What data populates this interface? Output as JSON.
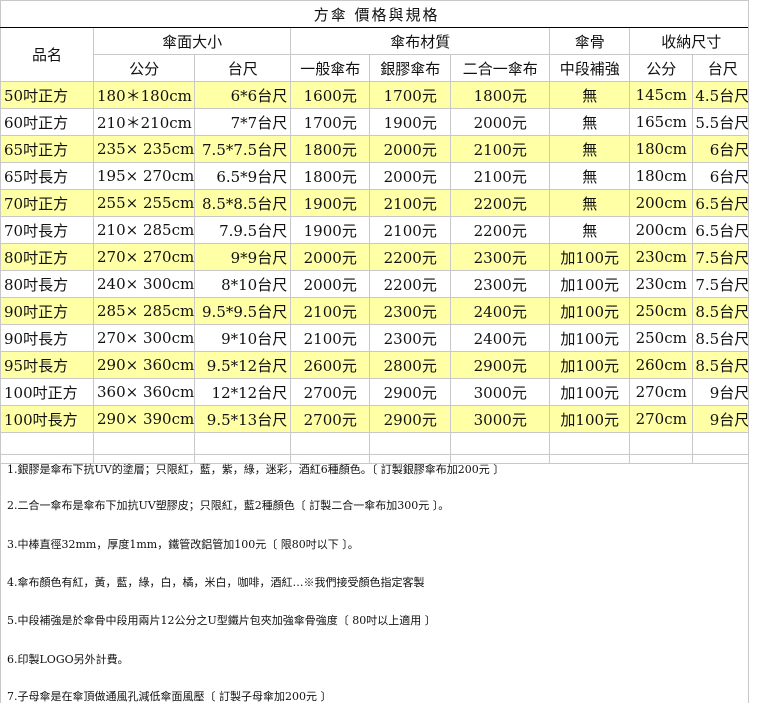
{
  "title": "方傘 價格與規格",
  "headers": {
    "product": "品名",
    "canopy": "傘面大小",
    "fabric": "傘布材質",
    "rib": "傘骨",
    "folded": "收納尺寸",
    "cm": "公分",
    "taichi": "台尺",
    "normal": "一般傘布",
    "silver": "銀膠傘布",
    "combo": "二合一傘布",
    "mid": "中段補強",
    "fcm": "公分",
    "ftai": "台尺"
  },
  "rows": [
    {
      "name": "50吋正方",
      "cm": "180＊180cm",
      "tai": "6*6台尺",
      "p1": "1600元",
      "p2": "1700元",
      "p3": "1800元",
      "mid": "無",
      "fcm": "145cm",
      "ftai": "4.5台尺",
      "hl": true
    },
    {
      "name": "60吋正方",
      "cm": "210＊210cm",
      "tai": "7*7台尺",
      "p1": "1700元",
      "p2": "1900元",
      "p3": "2000元",
      "mid": "無",
      "fcm": "165cm",
      "ftai": "5.5台尺",
      "hl": false
    },
    {
      "name": "65吋正方",
      "cm": "235× 235cm",
      "tai": "7.5*7.5台尺",
      "p1": "1800元",
      "p2": "2000元",
      "p3": "2100元",
      "mid": "無",
      "fcm": "180cm",
      "ftai": "6台尺",
      "hl": true
    },
    {
      "name": "65吋長方",
      "cm": "195× 270cm",
      "tai": "6.5*9台尺",
      "p1": "1800元",
      "p2": "2000元",
      "p3": "2100元",
      "mid": "無",
      "fcm": "180cm",
      "ftai": "6台尺",
      "hl": false
    },
    {
      "name": "70吋正方",
      "cm": "255× 255cm",
      "tai": "8.5*8.5台尺",
      "p1": "1900元",
      "p2": "2100元",
      "p3": "2200元",
      "mid": "無",
      "fcm": "200cm",
      "ftai": "6.5台尺",
      "hl": true
    },
    {
      "name": "70吋長方",
      "cm": "210× 285cm",
      "tai": "7.9.5台尺",
      "p1": "1900元",
      "p2": "2100元",
      "p3": "2200元",
      "mid": "無",
      "fcm": "200cm",
      "ftai": "6.5台尺",
      "hl": false
    },
    {
      "name": "80吋正方",
      "cm": "270× 270cm",
      "tai": "9*9台尺",
      "p1": "2000元",
      "p2": "2200元",
      "p3": "2300元",
      "mid": "加100元",
      "fcm": "230cm",
      "ftai": "7.5台尺",
      "hl": true
    },
    {
      "name": "80吋長方",
      "cm": "240× 300cm",
      "tai": "8*10台尺",
      "p1": "2000元",
      "p2": "2200元",
      "p3": "2300元",
      "mid": "加100元",
      "fcm": "230cm",
      "ftai": "7.5台尺",
      "hl": false
    },
    {
      "name": "90吋正方",
      "cm": "285× 285cm",
      "tai": "9.5*9.5台尺",
      "p1": "2100元",
      "p2": "2300元",
      "p3": "2400元",
      "mid": "加100元",
      "fcm": "250cm",
      "ftai": "8.5台尺",
      "hl": true
    },
    {
      "name": "90吋長方",
      "cm": "270× 300cm",
      "tai": "9*10台尺",
      "p1": "2100元",
      "p2": "2300元",
      "p3": "2400元",
      "mid": "加100元",
      "fcm": "250cm",
      "ftai": "8.5台尺",
      "hl": false
    },
    {
      "name": "95吋長方",
      "cm": "290× 360cm",
      "tai": "9.5*12台尺",
      "p1": "2600元",
      "p2": "2800元",
      "p3": "2900元",
      "mid": "加100元",
      "fcm": "260cm",
      "ftai": "8.5台尺",
      "hl": true
    },
    {
      "name": "100吋正方",
      "cm": "360× 360cm",
      "tai": "12*12台尺",
      "p1": "2700元",
      "p2": "2900元",
      "p3": "3000元",
      "mid": "加100元",
      "fcm": "270cm",
      "ftai": "9台尺",
      "hl": false
    },
    {
      "name": "100吋長方",
      "cm": "290× 390cm",
      "tai": "9.5*13台尺",
      "p1": "2700元",
      "p2": "2900元",
      "p3": "3000元",
      "mid": "加100元",
      "fcm": "270cm",
      "ftai": "9台尺",
      "hl": true
    }
  ],
  "notes": [
    "1.銀膠是傘布下抗UV的塗層；只限紅，藍，紫，綠，迷彩，酒紅6種顏色。〔 訂製銀膠傘布加200元 〕",
    "2.二合一傘布是傘布下加抗UV塑膠皮；只限紅，藍2種顏色〔 訂製二合一傘布加300元 〕。",
    "3.中棒直徑32mm，厚度1mm，鐵管改鋁管加100元〔 限80吋以下 〕。",
    "4.傘布顏色有紅，黃，藍，綠，白，橘，米白，咖啡，酒紅…※我們接受顏色指定客製",
    "5.中段補強是於傘骨中段用兩片12公分之U型鐵片包夾加強傘骨強度〔 80吋以上適用 〕",
    "6.印製LOGO另外計費。",
    "7.子母傘是在傘頂做通風孔減低傘面風壓〔 訂製子母傘加200元 〕"
  ],
  "colors": {
    "highlight": "#ffffa6",
    "grid": "#c8c8c8"
  }
}
